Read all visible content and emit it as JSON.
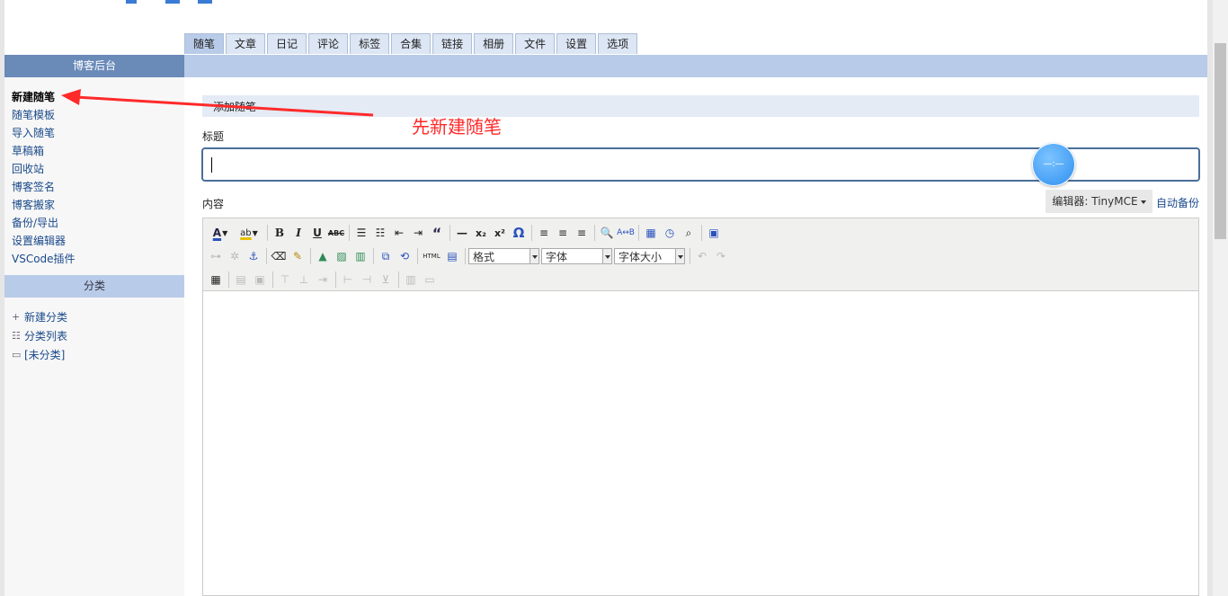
{
  "tabs": [
    "随笔",
    "文章",
    "日记",
    "评论",
    "标签",
    "合集",
    "链接",
    "相册",
    "文件",
    "设置",
    "选项"
  ],
  "active_tab": 0,
  "sidebar": {
    "header": "博客后台",
    "items": [
      "新建随笔",
      "随笔模板",
      "导入随笔",
      "草稿箱",
      "回收站",
      "博客签名",
      "博客搬家",
      "备份/导出",
      "设置编辑器",
      "VSCode插件"
    ],
    "active_item": 0,
    "category_header": "分类",
    "category_items": [
      {
        "icon": "plus-icon",
        "label": "新建分类"
      },
      {
        "icon": "list-icon",
        "label": "分类列表"
      },
      {
        "icon": "folder-icon",
        "label": "[未分类]"
      }
    ]
  },
  "main": {
    "section_title": "添加随笔",
    "title_label": "标题",
    "title_value": "",
    "content_label": "内容",
    "editor_select": "编辑器: TinyMCE",
    "auto_backup": "自动备份"
  },
  "toolbar": {
    "format_select": "格式",
    "font_select": "字体",
    "size_select": "字体大小",
    "bold": "B",
    "italic": "I",
    "underline": "U",
    "strike": "ABC",
    "quote": "“",
    "subscript": "x₂",
    "superscript": "x²",
    "omega": "Ω",
    "html": "HTML"
  },
  "annotation": {
    "text": "先新建随笔",
    "color": "#ff2a2a"
  },
  "colors": {
    "tab_bg": "#dce6f4",
    "tab_active": "#b8cbe8",
    "sidebar_header": "#6a8ab8",
    "link": "#1a4a8a"
  }
}
